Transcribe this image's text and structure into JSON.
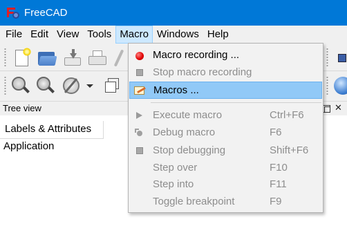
{
  "window": {
    "title": "FreeCAD"
  },
  "menubar": {
    "items": [
      {
        "label": "File"
      },
      {
        "label": "Edit"
      },
      {
        "label": "View"
      },
      {
        "label": "Tools"
      },
      {
        "label": "Macro",
        "active": true
      },
      {
        "label": "Windows"
      },
      {
        "label": "Help"
      }
    ]
  },
  "macro_menu": {
    "items": [
      {
        "label": "Macro recording ...",
        "shortcut": "",
        "icon": "record-icon",
        "enabled": true
      },
      {
        "label": "Stop macro recording",
        "shortcut": "",
        "icon": "stop-icon",
        "enabled": false
      },
      {
        "label": "Macros ...",
        "shortcut": "",
        "icon": "macros-edit-icon",
        "enabled": true,
        "highlighted": true
      },
      {
        "label": "Execute macro",
        "shortcut": "Ctrl+F6",
        "icon": "execute-icon",
        "enabled": false
      },
      {
        "label": "Debug macro",
        "shortcut": "F6",
        "icon": "debug-icon",
        "enabled": false
      },
      {
        "label": "Stop debugging",
        "shortcut": "Shift+F6",
        "icon": "stop-debug-icon",
        "enabled": false
      },
      {
        "label": "Step over",
        "shortcut": "F10",
        "icon": "",
        "enabled": false
      },
      {
        "label": "Step into",
        "shortcut": "F11",
        "icon": "",
        "enabled": false
      },
      {
        "label": "Toggle breakpoint",
        "shortcut": "F9",
        "icon": "",
        "enabled": false
      }
    ]
  },
  "tree_view": {
    "title": "Tree view",
    "tab_label": "Labels & Attributes",
    "root_item": "Application"
  },
  "colors": {
    "titlebar": "#0078d7",
    "menu_highlight": "#91c9f7",
    "menubar_active": "#cce8ff",
    "disabled_text": "#8d8d8d"
  }
}
